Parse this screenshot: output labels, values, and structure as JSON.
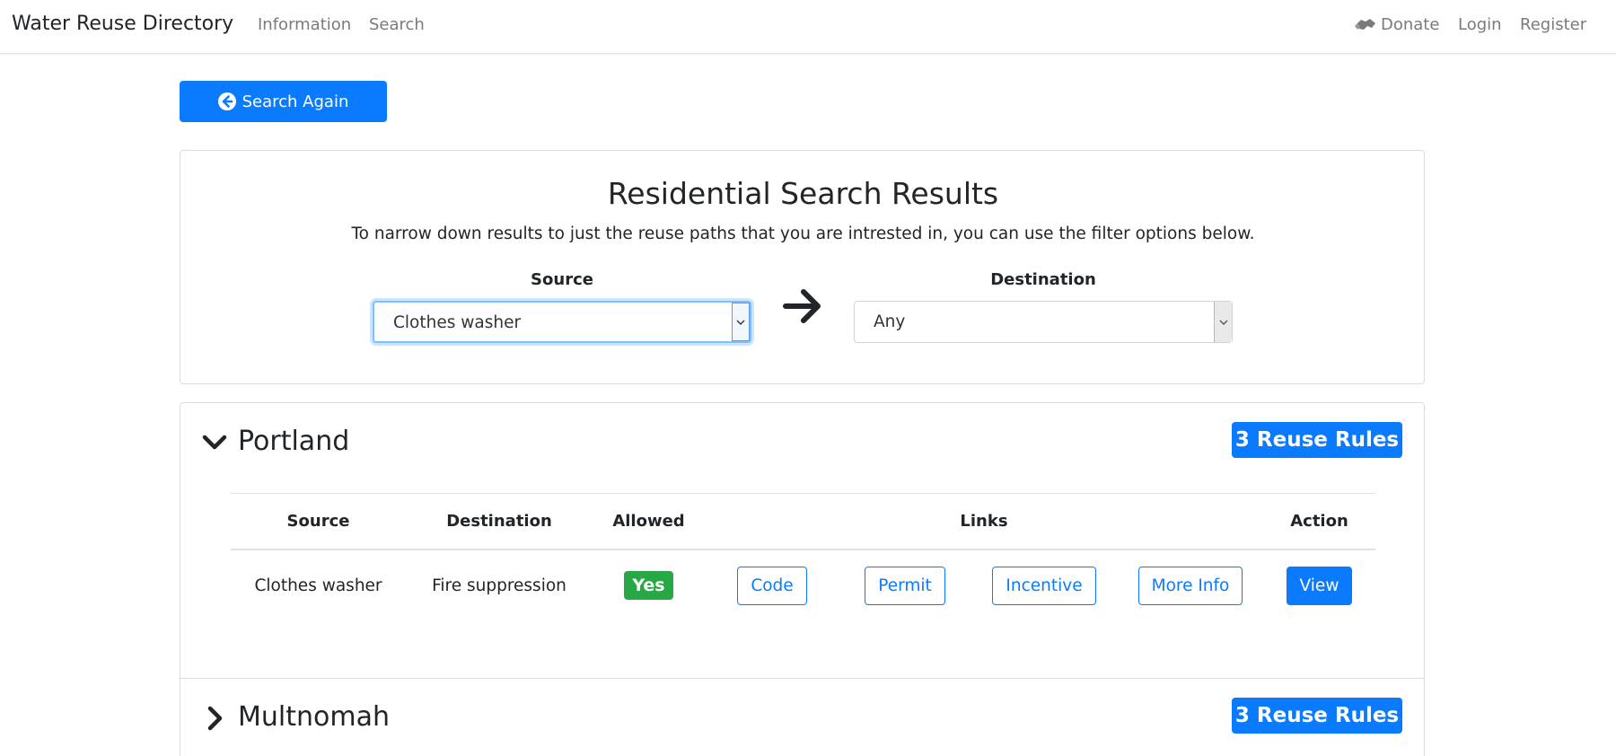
{
  "navbar": {
    "brand": "Water Reuse Directory",
    "links": [
      "Information",
      "Search"
    ],
    "right": {
      "donate": "Donate",
      "login": "Login",
      "register": "Register"
    }
  },
  "search_again_label": "Search Again",
  "filter": {
    "title": "Residential Search Results",
    "description": "To narrow down results to just the reuse paths that you are intrested in, you can use the filter options below.",
    "source_label": "Source",
    "source_value": "Clothes washer",
    "destination_label": "Destination",
    "destination_value": "Any"
  },
  "cities": [
    {
      "name": "Portland",
      "badge": "3 Reuse Rules",
      "expanded": true,
      "table": {
        "headers": {
          "source": "Source",
          "destination": "Destination",
          "allowed": "Allowed",
          "links": "Links",
          "action": "Action"
        },
        "rows": [
          {
            "source": "Clothes washer",
            "destination": "Fire suppression",
            "allowed": "Yes",
            "links": [
              "Code",
              "Permit",
              "Incentive",
              "More Info"
            ],
            "action": "View"
          }
        ]
      }
    },
    {
      "name": "Multnomah",
      "badge": "3 Reuse Rules",
      "expanded": false
    }
  ],
  "colors": {
    "primary": "#0a7bff",
    "success": "#28a745",
    "nav_text": "#7a7a7a",
    "text": "#212529"
  },
  "icons": {
    "donate": "handshake-icon",
    "search_again": "arrow-circle-left-icon",
    "filter_arrow": "arrow-right-icon",
    "expanded": "chevron-down-icon",
    "collapsed": "chevron-right-icon"
  }
}
